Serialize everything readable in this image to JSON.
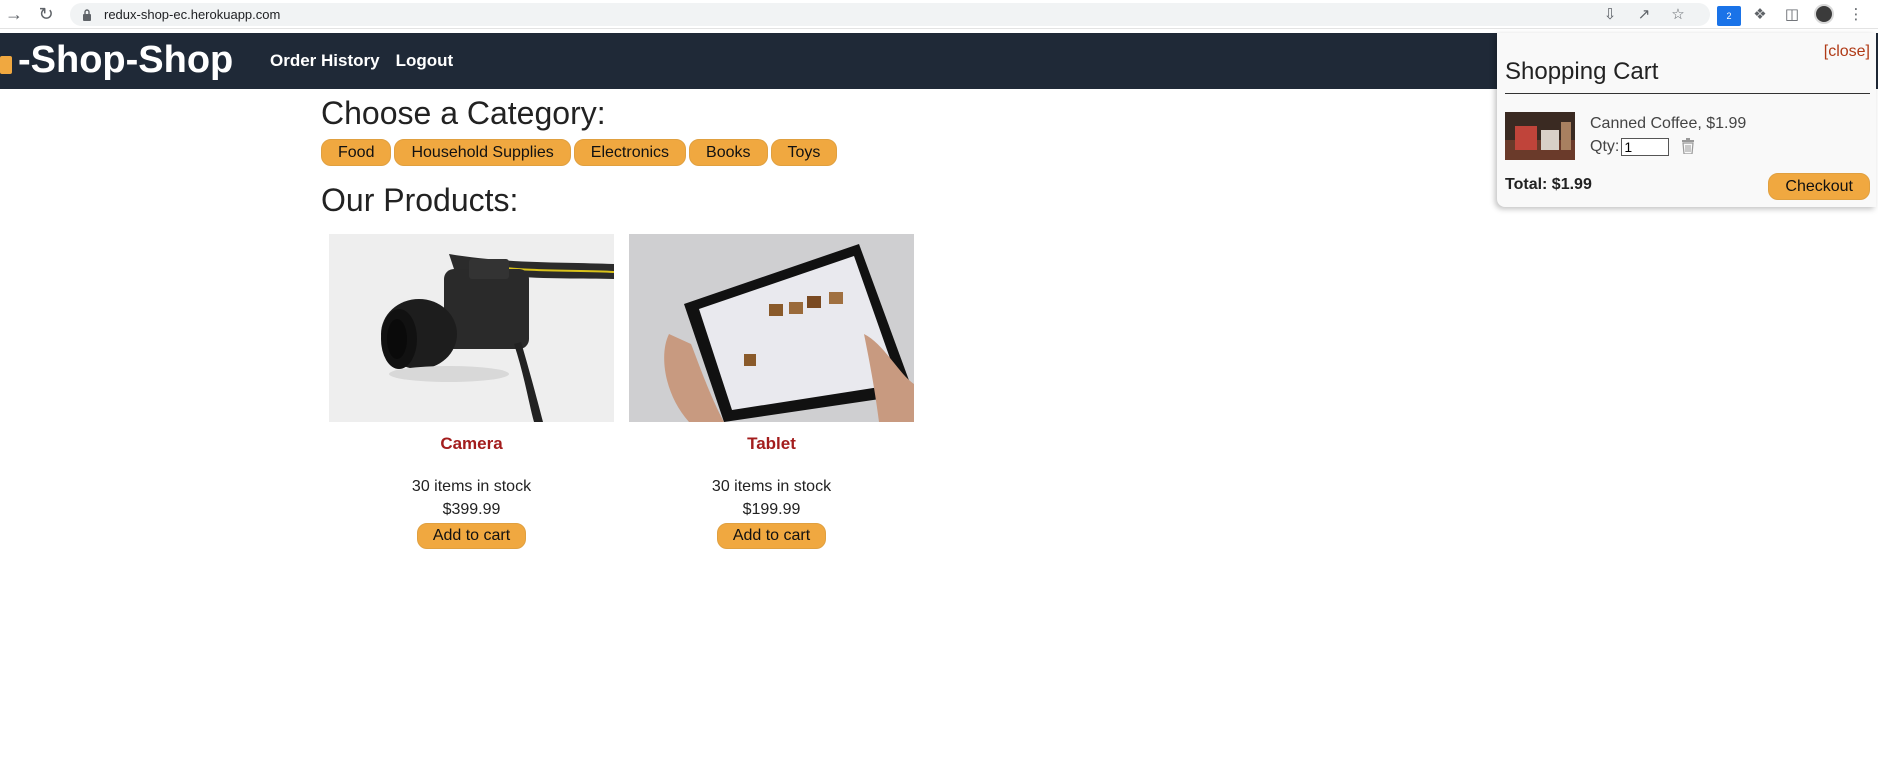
{
  "browser": {
    "url": "redux-shop-ec.herokuapp.com",
    "extension_badge": "2"
  },
  "header": {
    "brand": "-Shop-Shop",
    "nav": [
      "Order History",
      "Logout"
    ]
  },
  "categories": {
    "heading": "Choose a Category:",
    "items": [
      "Food",
      "Household Supplies",
      "Electronics",
      "Books",
      "Toys"
    ]
  },
  "products": {
    "heading": "Our Products:",
    "items": [
      {
        "name": "Camera",
        "stock": "30 items in stock",
        "price": "$399.99",
        "button": "Add to cart"
      },
      {
        "name": "Tablet",
        "stock": "30 items in stock",
        "price": "$199.99",
        "button": "Add to cart"
      }
    ]
  },
  "cart": {
    "close": "[close]",
    "title": "Shopping Cart",
    "item": {
      "name": "Canned Coffee, $1.99",
      "qty_label": "Qty:",
      "qty_value": "1"
    },
    "total": "Total: $1.99",
    "checkout": "Checkout"
  },
  "colors": {
    "header_bg": "#1f2937",
    "button_bg": "#f0a840",
    "product_name": "#a31d1d",
    "close_link": "#b03a16"
  }
}
